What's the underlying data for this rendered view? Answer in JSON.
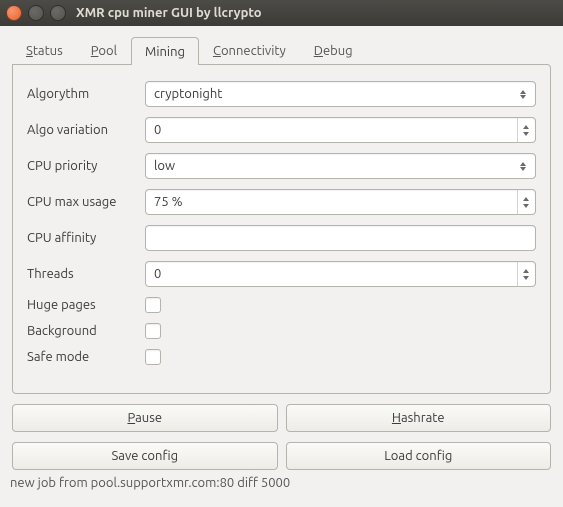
{
  "window": {
    "title": "XMR cpu miner GUI by llcrypto"
  },
  "tabs": {
    "status": "Status",
    "pool": "Pool",
    "mining": "Mining",
    "connectivity": "Connectivity",
    "debug": "Debug",
    "active": "mining"
  },
  "labels": {
    "algorythm": "Algorythm",
    "algo_variation": "Algo variation",
    "cpu_priority": "CPU priority",
    "cpu_max_usage": "CPU max usage",
    "cpu_affinity": "CPU affinity",
    "threads": "Threads",
    "huge_pages": "Huge pages",
    "background": "Background",
    "safe_mode": "Safe mode"
  },
  "values": {
    "algorythm": "cryptonight",
    "algo_variation": "0",
    "cpu_priority": "low",
    "cpu_max_usage": "75 %",
    "cpu_affinity": "",
    "threads": "0",
    "huge_pages": false,
    "background": false,
    "safe_mode": false
  },
  "buttons": {
    "pause": "Pause",
    "hashrate": "Hashrate",
    "save_config": "Save config",
    "load_config": "Load config"
  },
  "status": "new job from pool.supportxmr.com:80 diff 5000"
}
